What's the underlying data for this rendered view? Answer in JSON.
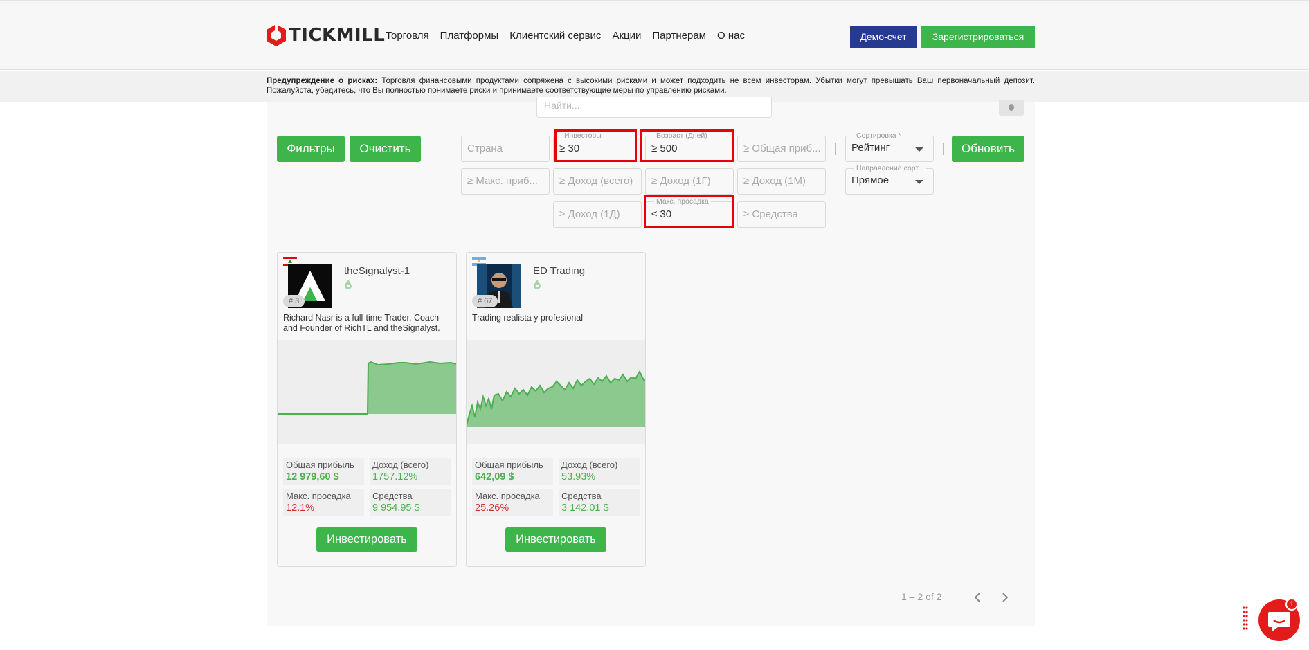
{
  "header": {
    "logo_text": "TICKMILL",
    "nav": [
      "Торговля",
      "Платформы",
      "Клиентский сервис",
      "Акции",
      "Партнерам",
      "О нас"
    ],
    "demo_label": "Демо-счет",
    "register_label": "Зарегистрироваться"
  },
  "risk": {
    "title": "Предупреждение о рисках:",
    "text": "Торговля финансовыми продуктами сопряжена с высокими рисками и может подходить не всем инвесторам. Убытки могут превышать Ваш первоначальный депозит. Пожалуйста, убедитесь, что Вы полностью понимаете риски и принимаете соответствующие меры по управлению рисками."
  },
  "search": {
    "placeholder": "Найти..."
  },
  "filters": {
    "filters_label": "Фильтры",
    "clear_label": "Очистить",
    "update_label": "Обновить",
    "country": "Страна",
    "investors_label": "Инвесторы",
    "investors_value": "≥ 30",
    "age_label": "Возраст (Дней)",
    "age_value": "≥ 500",
    "total_profit": "≥ Общая приб...",
    "sort_label": "Сортировка *",
    "sort_value": "Рейтинг",
    "max_profit": "≥ Макс. приб...",
    "income_total": "≥ Доход (всего)",
    "income_1y": "≥ Доход (1Г)",
    "income_1m": "≥ Доход (1М)",
    "sort_dir_label": "Направление сорт...",
    "sort_dir_value": "Прямое",
    "income_1d": "≥ Доход (1Д)",
    "max_dd_label": "Макс. просадка",
    "max_dd_value": "≤ 30",
    "funds": "≥ Средства"
  },
  "cards": [
    {
      "name": "theSignalyst-1",
      "rank": "# 3",
      "description": "Richard Nasr is a full-time Trader, Coach and Founder of RichTL and theSignalyst.",
      "stats": {
        "profit_label": "Общая прибыль",
        "profit": "12 979,60 $",
        "income_label": "Доход (всего)",
        "income": "1757.12%",
        "dd_label": "Макс. просадка",
        "dd": "12.1%",
        "funds_label": "Средства",
        "funds": "9 954,95 $"
      },
      "invest_label": "Инвестировать"
    },
    {
      "name": "ED Trading",
      "rank": "# 67",
      "description": "Trading realista y profesional",
      "stats": {
        "profit_label": "Общая прибыль",
        "profit": "642,09 $",
        "income_label": "Доход (всего)",
        "income": "53.93%",
        "dd_label": "Макс. просадка",
        "dd": "25.26%",
        "funds_label": "Средства",
        "funds": "3 142,01 $"
      },
      "invest_label": "Инвестировать"
    }
  ],
  "pagination": {
    "text": "1 – 2 of 2"
  },
  "chat": {
    "badge": "1"
  },
  "colors": {
    "brand_green": "#3db54a",
    "demo_blue": "#263a8f",
    "highlight_red": "#e8000b",
    "chat_red": "#e31b1b"
  }
}
